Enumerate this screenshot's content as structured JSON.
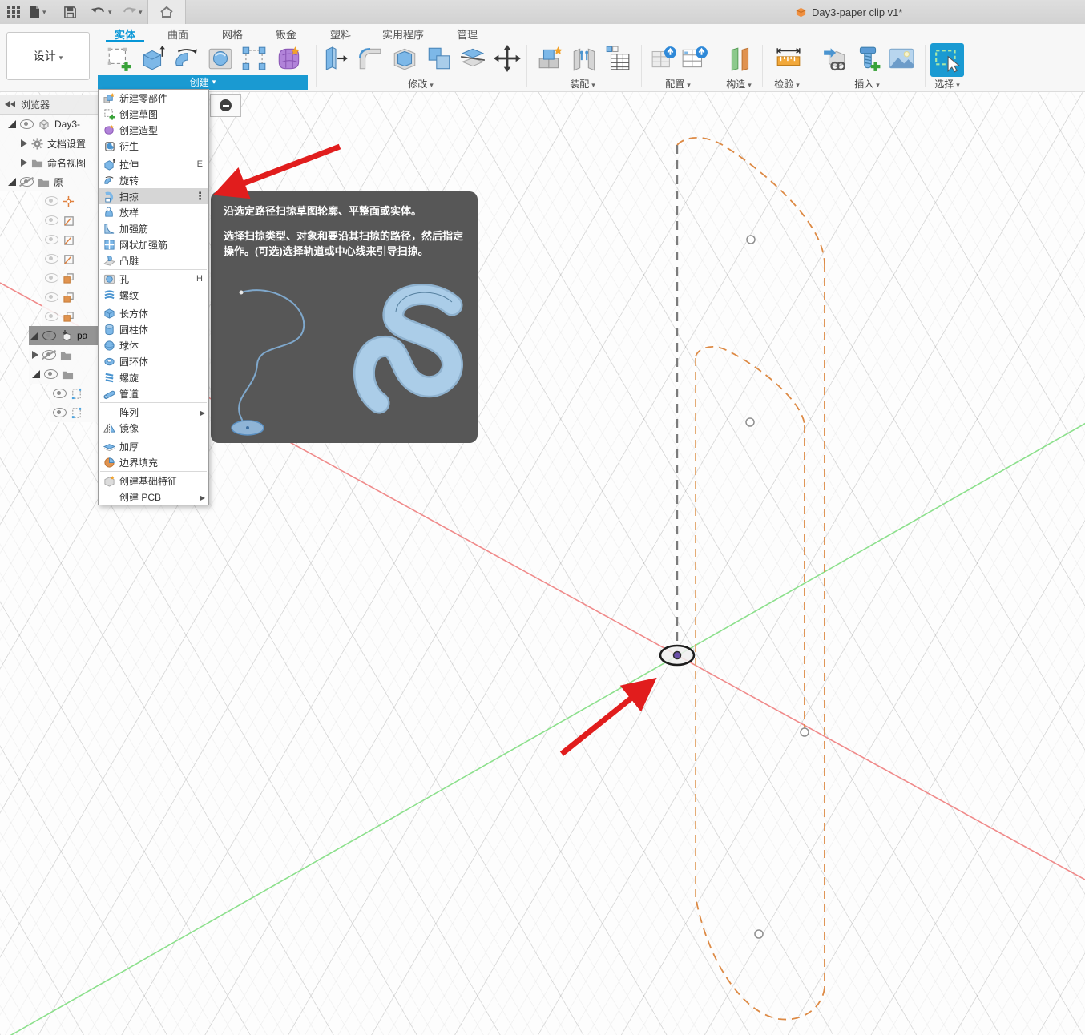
{
  "titlebar": {
    "title": "Day3-paper clip v1*"
  },
  "tabs": [
    {
      "label": "实体",
      "active": true
    },
    {
      "label": "曲面"
    },
    {
      "label": "网格"
    },
    {
      "label": "钣金"
    },
    {
      "label": "塑料"
    },
    {
      "label": "实用程序"
    },
    {
      "label": "管理"
    }
  ],
  "design_button": {
    "label": "设计"
  },
  "sections": [
    {
      "label": "创建",
      "open": true
    },
    {
      "label": "修改"
    },
    {
      "label": "装配"
    },
    {
      "label": "配置"
    },
    {
      "label": "构造"
    },
    {
      "label": "检验"
    },
    {
      "label": "插入"
    },
    {
      "label": "选择"
    }
  ],
  "menu": {
    "items": [
      {
        "label": "新建零部件"
      },
      {
        "label": "创建草图"
      },
      {
        "label": "创建造型"
      },
      {
        "label": "衍生"
      },
      {
        "label": "拉伸",
        "shortcut": "E"
      },
      {
        "label": "旋转"
      },
      {
        "label": "扫掠",
        "highlighted": true
      },
      {
        "label": "放样"
      },
      {
        "label": "加强筋"
      },
      {
        "label": "网状加强筋"
      },
      {
        "label": "凸雕"
      },
      {
        "label": "孔",
        "shortcut": "H"
      },
      {
        "label": "螺纹"
      },
      {
        "label": "长方体"
      },
      {
        "label": "圆柱体"
      },
      {
        "label": "球体"
      },
      {
        "label": "圆环体"
      },
      {
        "label": "螺旋"
      },
      {
        "label": "管道"
      },
      {
        "label": "阵列",
        "submenu": true
      },
      {
        "label": "镜像"
      },
      {
        "label": "加厚"
      },
      {
        "label": "边界填充"
      },
      {
        "label": "创建基础特征"
      },
      {
        "label": "创建 PCB",
        "submenu": true
      }
    ]
  },
  "tooltip": {
    "p1": "沿选定路径扫掠草图轮廓、平整面或实体。",
    "p2": "选择扫掠类型、对象和要沿其扫掠的路径，然后指定操作。(可选)选择轨道或中心线来引导扫掠。"
  },
  "browser": {
    "header": "浏览器",
    "rows": [
      {
        "label": "Day3-"
      },
      {
        "label": "文档设置"
      },
      {
        "label": "命名视图"
      },
      {
        "label": "原"
      },
      {
        "label": "pa"
      }
    ]
  },
  "colors": {
    "accent_blue": "#0696d7",
    "create_bar_blue": "#1a9ad2",
    "sketch_orange": "#dd8a45",
    "axis_red": "#f08a8a",
    "axis_green": "#8ce08c",
    "annotation_red": "#e11d1d",
    "tooltip_bg": "#575757"
  }
}
